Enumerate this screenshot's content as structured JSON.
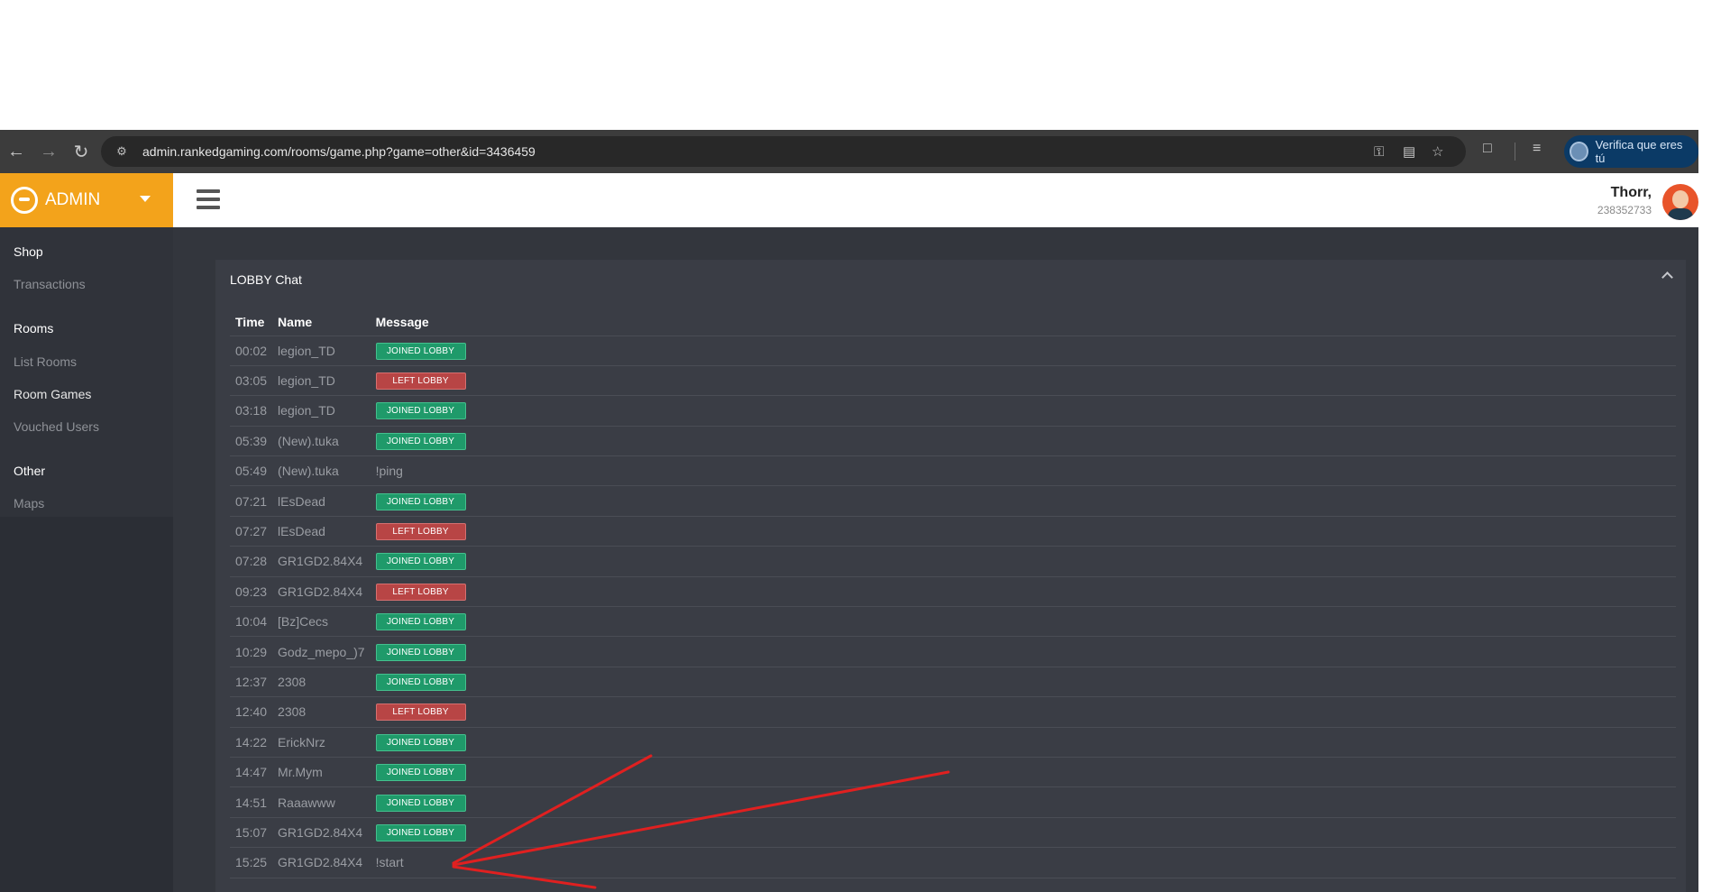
{
  "browser": {
    "url": "admin.rankedgaming.com/rooms/game.php?game=other&id=3436459",
    "verify_label": "Verifica que eres tú"
  },
  "brand": {
    "name": "ADMIN"
  },
  "user": {
    "name": "Thorr,",
    "id": "238352733"
  },
  "sidebar": {
    "sections": [
      {
        "label": "Shop",
        "items": [
          "Transactions"
        ]
      },
      {
        "label": "Rooms",
        "items": [
          "List Rooms",
          "Room Games",
          "Vouched Users"
        ]
      },
      {
        "label": "Other",
        "items": [
          "Maps"
        ]
      }
    ],
    "active_item": "Room Games"
  },
  "panel": {
    "title": "LOBBY Chat",
    "columns": [
      "Time",
      "Name",
      "Message"
    ],
    "rows": [
      {
        "time": "00:02",
        "name": "legion_TD",
        "message": "JOINED LOBBY",
        "kind": "joined"
      },
      {
        "time": "03:05",
        "name": "legion_TD",
        "message": "LEFT LOBBY",
        "kind": "left"
      },
      {
        "time": "03:18",
        "name": "legion_TD",
        "message": "JOINED LOBBY",
        "kind": "joined"
      },
      {
        "time": "05:39",
        "name": "(New).tuka",
        "message": "JOINED LOBBY",
        "kind": "joined"
      },
      {
        "time": "05:49",
        "name": "(New).tuka",
        "message": "!ping",
        "kind": "text"
      },
      {
        "time": "07:21",
        "name": "lEsDead",
        "message": "JOINED LOBBY",
        "kind": "joined"
      },
      {
        "time": "07:27",
        "name": "lEsDead",
        "message": "LEFT LOBBY",
        "kind": "left"
      },
      {
        "time": "07:28",
        "name": "GR1GD2.84X4",
        "message": "JOINED LOBBY",
        "kind": "joined"
      },
      {
        "time": "09:23",
        "name": "GR1GD2.84X4",
        "message": "LEFT LOBBY",
        "kind": "left"
      },
      {
        "time": "10:04",
        "name": "[Bz]Cecs",
        "message": "JOINED LOBBY",
        "kind": "joined"
      },
      {
        "time": "10:29",
        "name": "Godz_mepo_)7",
        "message": "JOINED LOBBY",
        "kind": "joined"
      },
      {
        "time": "12:37",
        "name": "2308",
        "message": "JOINED LOBBY",
        "kind": "joined"
      },
      {
        "time": "12:40",
        "name": "2308",
        "message": "LEFT LOBBY",
        "kind": "left"
      },
      {
        "time": "14:22",
        "name": "ErickNrz",
        "message": "JOINED LOBBY",
        "kind": "joined"
      },
      {
        "time": "14:47",
        "name": "Mr.Mym",
        "message": "JOINED LOBBY",
        "kind": "joined"
      },
      {
        "time": "14:51",
        "name": "Raaawww",
        "message": "JOINED LOBBY",
        "kind": "joined"
      },
      {
        "time": "15:07",
        "name": "GR1GD2.84X4",
        "message": "JOINED LOBBY",
        "kind": "joined"
      },
      {
        "time": "15:25",
        "name": "GR1GD2.84X4",
        "message": "!start",
        "kind": "text"
      }
    ]
  },
  "icons": [
    "back-icon",
    "forward-icon",
    "reload-icon",
    "site-info-icon",
    "key-icon",
    "translate-icon",
    "star-icon",
    "extensions-icon",
    "media-icon",
    "hamburger-icon",
    "chevron-up-icon"
  ],
  "colors": {
    "brand": "#f3a31b",
    "joined": "#1f9a6a",
    "left": "#b84545",
    "annotation": "#e02020"
  }
}
